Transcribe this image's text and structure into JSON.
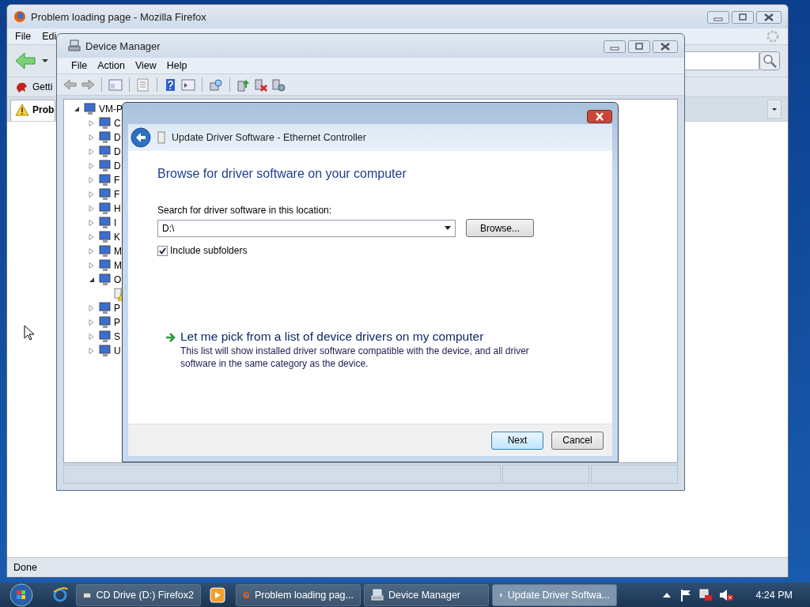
{
  "firefox": {
    "title": "Problem loading page - Mozilla Firefox",
    "menu": [
      "File",
      "Edi"
    ],
    "bookmark": "Getti",
    "tab": {
      "label": "Prob",
      "selected": true
    },
    "status_bar": "Done"
  },
  "device_manager": {
    "title": "Device Manager",
    "menu": [
      "File",
      "Action",
      "View",
      "Help"
    ],
    "tree": [
      {
        "label": "VM-P",
        "expanded": true,
        "children": [
          {
            "label": "C",
            "expanded": false
          },
          {
            "label": "D",
            "expanded": false
          },
          {
            "label": "D",
            "expanded": false
          },
          {
            "label": "D",
            "expanded": false
          },
          {
            "label": "F",
            "expanded": false
          },
          {
            "label": "F",
            "expanded": false
          },
          {
            "label": "H",
            "expanded": false
          },
          {
            "label": "I",
            "expanded": false
          },
          {
            "label": "K",
            "expanded": false
          },
          {
            "label": "M",
            "expanded": false
          },
          {
            "label": "M",
            "expanded": false
          },
          {
            "label": "O",
            "expanded": true,
            "children": [
              {
                "warning": true
              }
            ]
          },
          {
            "label": "P",
            "expanded": false
          },
          {
            "label": "P",
            "expanded": false
          },
          {
            "label": "S",
            "expanded": false
          },
          {
            "label": "U",
            "expanded": false
          }
        ]
      }
    ]
  },
  "dialog": {
    "title": "Update Driver Software - Ethernet Controller",
    "heading": "Browse for driver software on your computer",
    "location_label": "Search for driver software in this location:",
    "location_value": "D:\\",
    "browse_button": "Browse...",
    "include_subfolders": {
      "label": "Include subfolders",
      "checked": true
    },
    "link": {
      "title": "Let me pick from a list of device drivers on my computer",
      "description": "This list will show installed driver software compatible with the device, and all driver software in the same category as the device."
    },
    "buttons": [
      {
        "label": "Next",
        "default": true
      },
      {
        "label": "Cancel",
        "default": false
      }
    ]
  },
  "taskbar": {
    "buttons": [
      {
        "label": "CD Drive (D:) Firefox2",
        "selected": false
      },
      {
        "label": "Problem loading pag...",
        "selected": false
      },
      {
        "label": "Device Manager",
        "selected": false
      },
      {
        "label": "Update Driver Softwa...",
        "selected": true
      }
    ],
    "clock": "4:24 PM"
  }
}
